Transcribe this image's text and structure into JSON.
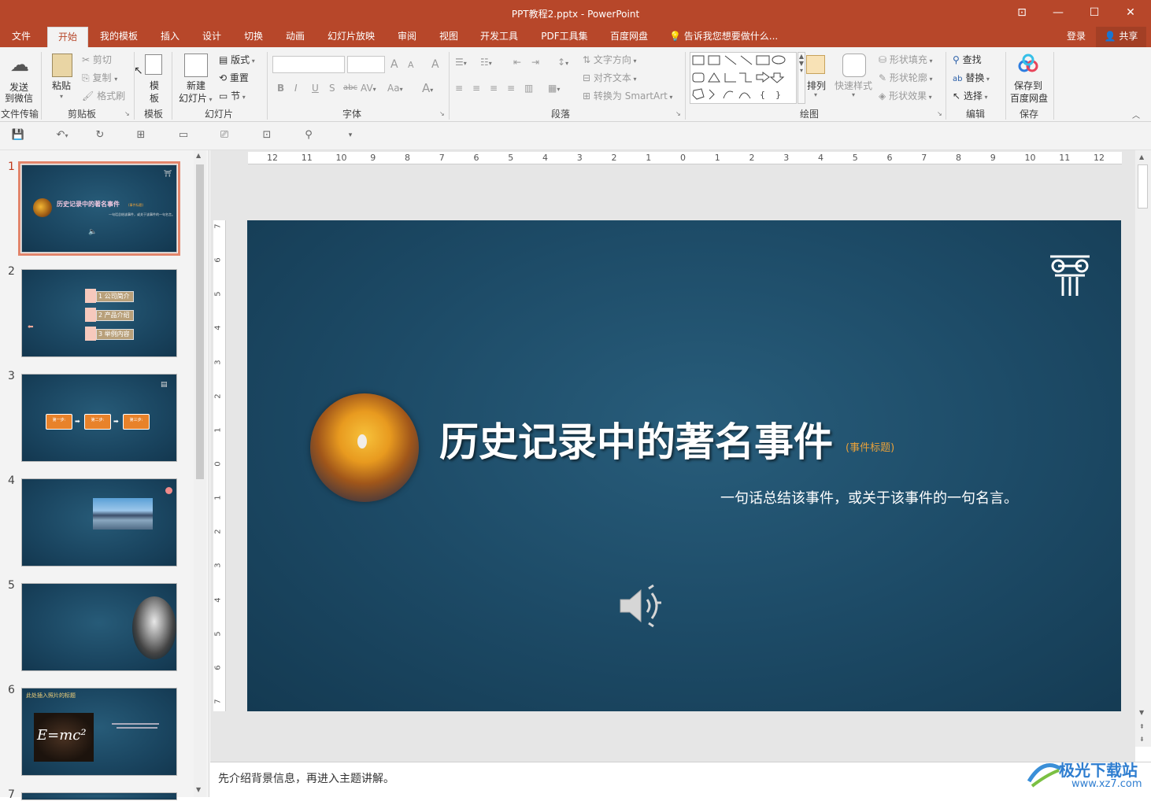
{
  "window": {
    "title": "PPT教程2.pptx - PowerPoint",
    "controls": [
      "ribbon-display",
      "minimize",
      "maximize",
      "close"
    ]
  },
  "tabs": [
    {
      "label": "文件",
      "active": false
    },
    {
      "label": "开始",
      "active": true
    },
    {
      "label": "我的模板",
      "active": false
    },
    {
      "label": "插入",
      "active": false
    },
    {
      "label": "设计",
      "active": false
    },
    {
      "label": "切换",
      "active": false
    },
    {
      "label": "动画",
      "active": false
    },
    {
      "label": "幻灯片放映",
      "active": false
    },
    {
      "label": "审阅",
      "active": false
    },
    {
      "label": "视图",
      "active": false
    },
    {
      "label": "开发工具",
      "active": false
    },
    {
      "label": "PDF工具集",
      "active": false
    },
    {
      "label": "百度网盘",
      "active": false
    }
  ],
  "tell_me": "告诉我您想要做什么...",
  "account": {
    "login": "登录",
    "share": "共享"
  },
  "ribbon": {
    "file_transfer": {
      "send_line1": "发送",
      "send_line2": "到微信",
      "label": "文件传输"
    },
    "clipboard": {
      "paste": "粘贴",
      "cut": "剪切",
      "copy": "复制",
      "format_painter": "格式刷",
      "label": "剪贴板"
    },
    "template": {
      "btn_line1": "模",
      "btn_line2": "板",
      "label": "模板"
    },
    "slides": {
      "new_line1": "新建",
      "new_line2": "幻灯片",
      "layout": "版式",
      "reset": "重置",
      "section": "节",
      "label": "幻灯片"
    },
    "font": {
      "bold": "B",
      "italic": "I",
      "underline": "U",
      "shadow": "S",
      "strike": "abc",
      "spacing": "AV",
      "case": "Aa",
      "grow": "A",
      "shrink": "A",
      "clear": "A",
      "color": "A",
      "label": "字体"
    },
    "paragraph": {
      "text_direction": "文字方向",
      "align_text": "对齐文本",
      "smartart": "转换为 SmartArt",
      "label": "段落"
    },
    "drawing": {
      "arrange": "排列",
      "quick_styles": "快速样式",
      "shape_fill": "形状填充",
      "shape_outline": "形状轮廓",
      "shape_effects": "形状效果",
      "label": "绘图"
    },
    "editing": {
      "find": "查找",
      "replace": "替换",
      "select": "选择",
      "label": "编辑"
    },
    "save": {
      "btn_line1": "保存到",
      "btn_line2": "百度网盘",
      "label": "保存"
    }
  },
  "thumbnails": [
    {
      "num": "1",
      "selected": true,
      "title": "历史记录中的著名事件",
      "tag": "(事件标题)",
      "subtitle": "一句话总结该事件，或关于该事件的一句名言。"
    },
    {
      "num": "2",
      "items": [
        "1 公司简介",
        "2 产品介绍",
        "3 举例内容"
      ]
    },
    {
      "num": "3",
      "steps": [
        "第一步:",
        "第二步:",
        "第三步:"
      ]
    },
    {
      "num": "4"
    },
    {
      "num": "5"
    },
    {
      "num": "6",
      "title": "此处插入照片的标题",
      "formula": "E=mc²"
    },
    {
      "num": "7"
    }
  ],
  "ruler": {
    "h_ticks": [
      "12",
      "11",
      "10",
      "9",
      "8",
      "7",
      "6",
      "5",
      "4",
      "3",
      "2",
      "1",
      "0",
      "1",
      "2",
      "3",
      "4",
      "5",
      "6",
      "7",
      "8",
      "9",
      "10",
      "11",
      "12"
    ],
    "v_ticks": [
      "7",
      "6",
      "5",
      "4",
      "3",
      "2",
      "1",
      "0",
      "1",
      "2",
      "3",
      "4",
      "5",
      "6",
      "7"
    ]
  },
  "slide": {
    "title": "历史记录中的著名事件",
    "title_tag": "(事件标题)",
    "subtitle": "一句话总结该事件，或关于该事件的一句名言。"
  },
  "notes": "先介绍背景信息，再进入主题讲解。",
  "watermark": {
    "name": "极光下载站",
    "url": "www.xz7.com"
  },
  "colors": {
    "brand": "#b7472a",
    "ribbon_bg": "#f3f3f3",
    "slide_bg": "#1d4b67",
    "accent_orange": "#e8822a",
    "title_tag": "#e8a13a"
  }
}
